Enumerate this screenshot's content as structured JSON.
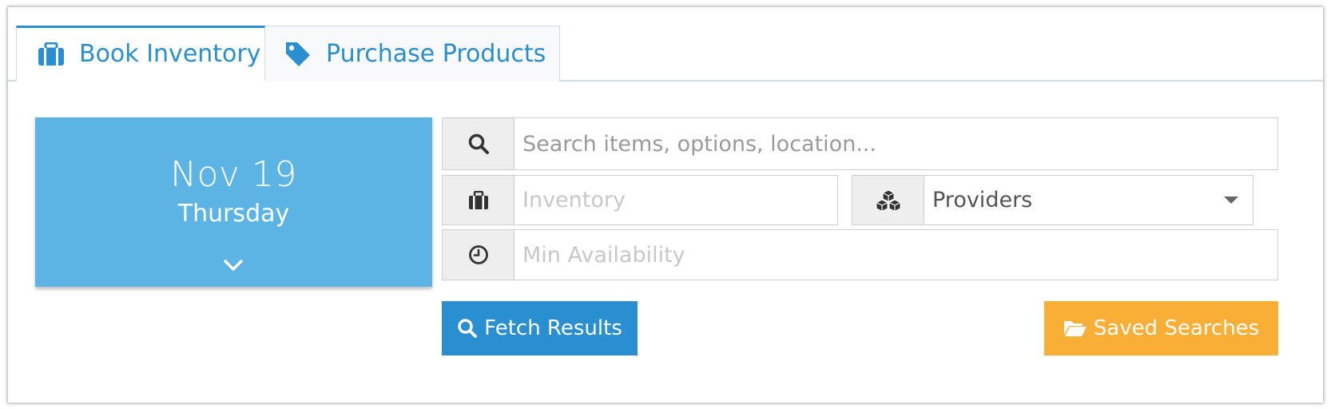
{
  "colors": {
    "accent": "#2a8fd1",
    "date_card": "#5cb4e5",
    "saved_button": "#f9ae35",
    "addon_bg": "#eeeeee"
  },
  "tabs": [
    {
      "label": "Book Inventory",
      "icon": "briefcase-icon",
      "active": true
    },
    {
      "label": "Purchase Products",
      "icon": "tag-icon",
      "active": false
    }
  ],
  "date_card": {
    "date": "Nov 19",
    "weekday": "Thursday",
    "icon": "chevron-down-icon"
  },
  "search": {
    "icon": "search-icon",
    "placeholder": "Search items, options, location..."
  },
  "inventory": {
    "icon": "briefcase-icon",
    "placeholder": "Inventory"
  },
  "providers": {
    "icon": "cubes-icon",
    "selected": "Providers"
  },
  "min_availability": {
    "icon": "clock-icon",
    "placeholder": "Min Availability"
  },
  "buttons": {
    "fetch": {
      "label": "Fetch Results",
      "icon": "search-icon"
    },
    "saved": {
      "label": "Saved Searches",
      "icon": "folder-open-icon"
    }
  }
}
